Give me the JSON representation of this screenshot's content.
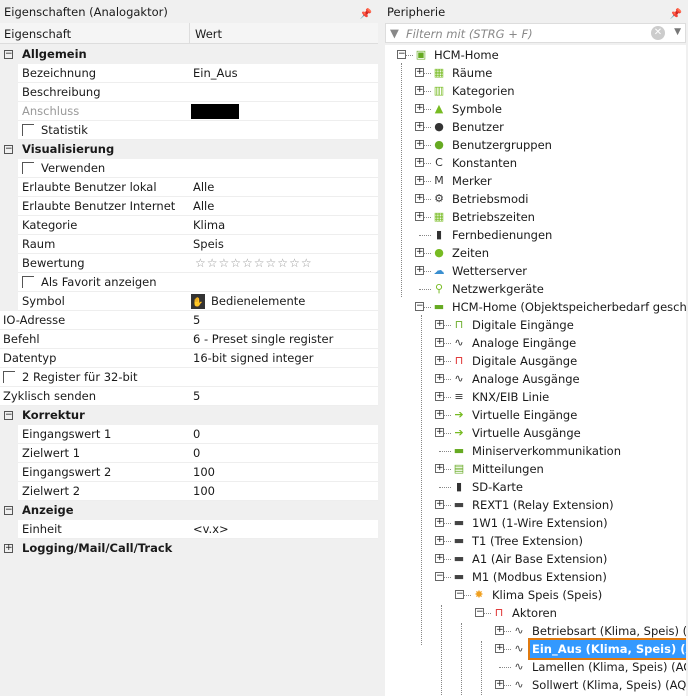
{
  "left": {
    "title": "Eigenschaften (Analogaktor)",
    "col_name": "Eigenschaft",
    "col_value": "Wert",
    "rows": [
      {
        "t": "cat",
        "name": "Allgemein"
      },
      {
        "t": "item",
        "name": "Bezeichnung",
        "value": "Ein_Aus"
      },
      {
        "t": "item",
        "name": "Beschreibung",
        "value": ""
      },
      {
        "t": "item",
        "name": "Anschluss",
        "value": "",
        "dim": true,
        "redacted": true
      },
      {
        "t": "check",
        "name": "Statistik"
      },
      {
        "t": "cat",
        "name": "Visualisierung"
      },
      {
        "t": "check",
        "name": "Verwenden"
      },
      {
        "t": "item",
        "name": "Erlaubte Benutzer lokal",
        "value": "Alle"
      },
      {
        "t": "item",
        "name": "Erlaubte Benutzer Internet",
        "value": "Alle"
      },
      {
        "t": "item",
        "name": "Kategorie",
        "value": "Klima"
      },
      {
        "t": "item",
        "name": "Raum",
        "value": "Speis"
      },
      {
        "t": "stars",
        "name": "Bewertung",
        "rating": 0,
        "max": 10
      },
      {
        "t": "check",
        "name": "Als Favorit anzeigen"
      },
      {
        "t": "item",
        "name": "Symbol",
        "value": "Bedienelemente",
        "icon": true
      },
      {
        "t": "top",
        "name": "IO-Adresse",
        "value": "5"
      },
      {
        "t": "top",
        "name": "Befehl",
        "value": "6 - Preset single register"
      },
      {
        "t": "top",
        "name": "Datentyp",
        "value": "16-bit signed integer"
      },
      {
        "t": "topcheck",
        "name": "2 Register für 32-bit"
      },
      {
        "t": "top",
        "name": "Zyklisch senden",
        "value": "5"
      },
      {
        "t": "cat",
        "name": "Korrektur"
      },
      {
        "t": "item",
        "name": "Eingangswert 1",
        "value": "0"
      },
      {
        "t": "item",
        "name": "Zielwert 1",
        "value": "0"
      },
      {
        "t": "item",
        "name": "Eingangswert 2",
        "value": "100"
      },
      {
        "t": "item",
        "name": "Zielwert 2",
        "value": "100"
      },
      {
        "t": "cat",
        "name": "Anzeige"
      },
      {
        "t": "item",
        "name": "Einheit",
        "value": "<v.x>"
      },
      {
        "t": "catc",
        "name": "Logging/Mail/Call/Track"
      }
    ]
  },
  "right": {
    "title": "Peripherie",
    "filter_placeholder": "Filtern mit (STRG + F)",
    "nodes": [
      {
        "l": 0,
        "e": "-",
        "i": "home",
        "label": "HCM-Home"
      },
      {
        "l": 1,
        "e": "+",
        "i": "rooms",
        "label": "Räume"
      },
      {
        "l": 1,
        "e": "+",
        "i": "categories",
        "label": "Kategorien"
      },
      {
        "l": 1,
        "e": "+",
        "i": "symbols",
        "label": "Symbole"
      },
      {
        "l": 1,
        "e": "+",
        "i": "user",
        "label": "Benutzer"
      },
      {
        "l": 1,
        "e": "+",
        "i": "usergroup",
        "label": "Benutzergruppen"
      },
      {
        "l": 1,
        "e": "+",
        "i": "constants",
        "label": "Konstanten"
      },
      {
        "l": 1,
        "e": "+",
        "i": "marker",
        "label": "Merker"
      },
      {
        "l": 1,
        "e": "+",
        "i": "gear",
        "label": "Betriebsmodi"
      },
      {
        "l": 1,
        "e": "+",
        "i": "calendar",
        "label": "Betriebszeiten"
      },
      {
        "l": 1,
        "e": "",
        "i": "remote",
        "label": "Fernbedienungen"
      },
      {
        "l": 1,
        "e": "+",
        "i": "clock",
        "label": "Zeiten"
      },
      {
        "l": 1,
        "e": "+",
        "i": "weather",
        "label": "Wetterserver"
      },
      {
        "l": 1,
        "e": "",
        "i": "network",
        "label": "Netzwerkgeräte"
      },
      {
        "l": 1,
        "e": "-",
        "i": "miniserver",
        "label": "HCM-Home (Objektspeicherbedarf geschätzt"
      },
      {
        "l": 2,
        "e": "+",
        "i": "digital-in",
        "label": "Digitale Eingänge"
      },
      {
        "l": 2,
        "e": "+",
        "i": "analog-in",
        "label": "Analoge Eingänge"
      },
      {
        "l": 2,
        "e": "+",
        "i": "digital-out",
        "label": "Digitale Ausgänge"
      },
      {
        "l": 2,
        "e": "+",
        "i": "analog-out",
        "label": "Analoge Ausgänge"
      },
      {
        "l": 2,
        "e": "+",
        "i": "knx",
        "label": "KNX/EIB Linie"
      },
      {
        "l": 2,
        "e": "+",
        "i": "virtual-in",
        "label": "Virtuelle Eingänge"
      },
      {
        "l": 2,
        "e": "+",
        "i": "virtual-out",
        "label": "Virtuelle Ausgänge"
      },
      {
        "l": 2,
        "e": "",
        "i": "miniserver",
        "label": "Miniserverkommunikation"
      },
      {
        "l": 2,
        "e": "+",
        "i": "messages",
        "label": "Mitteilungen"
      },
      {
        "l": 2,
        "e": "",
        "i": "sdcard",
        "label": "SD-Karte"
      },
      {
        "l": 2,
        "e": "+",
        "i": "ext",
        "label": "REXT1 (Relay Extension)"
      },
      {
        "l": 2,
        "e": "+",
        "i": "ext",
        "label": "1W1 (1-Wire Extension)"
      },
      {
        "l": 2,
        "e": "+",
        "i": "ext",
        "label": "T1 (Tree Extension)"
      },
      {
        "l": 2,
        "e": "+",
        "i": "ext",
        "label": "A1 (Air Base Extension)"
      },
      {
        "l": 2,
        "e": "-",
        "i": "modbus",
        "label": "M1 (Modbus Extension)"
      },
      {
        "l": 3,
        "e": "-",
        "i": "device",
        "label": "Klima Speis (Speis)"
      },
      {
        "l": 4,
        "e": "-",
        "i": "actors",
        "label": "Aktoren"
      },
      {
        "l": 5,
        "e": "+",
        "i": "analog-actor",
        "label": "Betriebsart (Klima, Speis) (AQ)"
      },
      {
        "l": 5,
        "e": "+",
        "i": "analog-actor",
        "label": "Ein_Aus (Klima, Speis) (AQ)",
        "selected": true
      },
      {
        "l": 5,
        "e": "",
        "i": "analog-actor",
        "label": "Lamellen (Klima, Speis) (AQ)"
      },
      {
        "l": 5,
        "e": "+",
        "i": "analog-actor",
        "label": "Sollwert (Klima, Speis) (AQ)"
      }
    ]
  }
}
